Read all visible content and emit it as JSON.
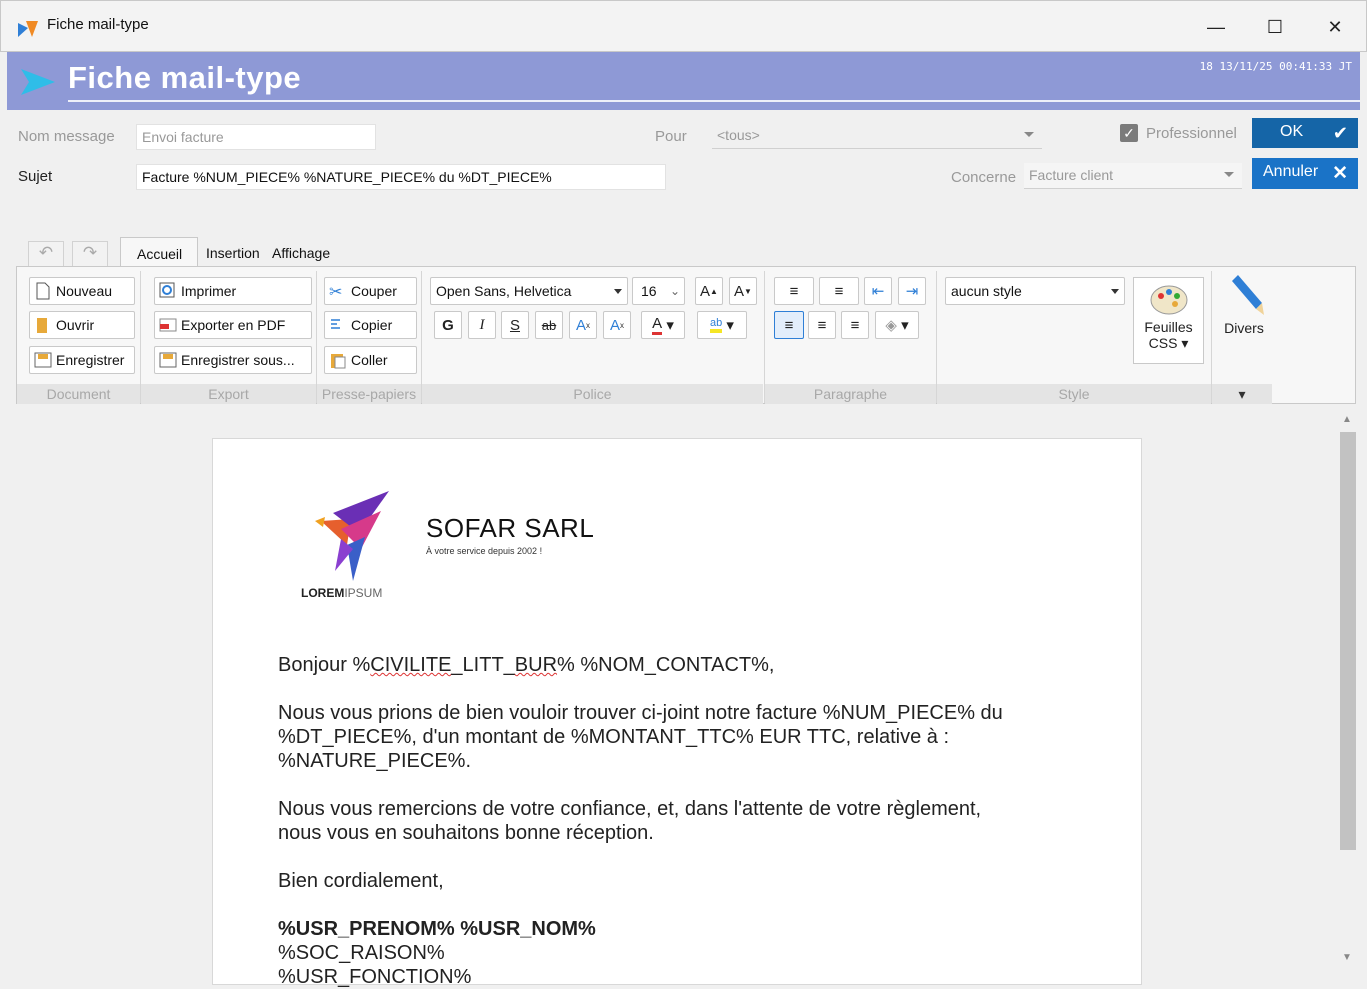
{
  "window": {
    "title": "Fiche mail-type"
  },
  "banner": {
    "title": "Fiche mail-type",
    "meta": "18  13/11/25 00:41:33  JT"
  },
  "form": {
    "nom_message_label": "Nom message",
    "nom_message_value": "Envoi facture",
    "sujet_label": "Sujet",
    "sujet_value": "Facture %NUM_PIECE% %NATURE_PIECE% du %DT_PIECE%",
    "pour_label": "Pour",
    "pour_value": "<tous>",
    "professionnel_label": "Professionnel",
    "professionnel_checked": true,
    "concerne_label": "Concerne",
    "concerne_value": "Facture client",
    "ok_label": "OK",
    "annuler_label": "Annuler"
  },
  "ribbon": {
    "tabs": [
      "Accueil",
      "Insertion",
      "Affichage"
    ],
    "active_tab": "Accueil",
    "document": {
      "nouveau": "Nouveau",
      "ouvrir": "Ouvrir",
      "enregistrer": "Enregistrer",
      "group": "Document"
    },
    "export": {
      "imprimer": "Imprimer",
      "pdf": "Exporter en PDF",
      "enregistrer_sous": "Enregistrer sous...",
      "group": "Export"
    },
    "presse": {
      "couper": "Couper",
      "copier": "Copier",
      "coller": "Coller",
      "group": "Presse-papiers"
    },
    "police": {
      "font": "Open Sans, Helvetica",
      "size": "16",
      "group": "Police",
      "bold": "G",
      "italic": "I",
      "underline": "S",
      "strike": "ab"
    },
    "paragraphe": {
      "group": "Paragraphe"
    },
    "style": {
      "value": "aucun style",
      "feuilles_line1": "Feuilles",
      "feuilles_line2": "CSS",
      "group": "Style"
    },
    "divers": {
      "label": "Divers"
    }
  },
  "document": {
    "company": "SOFAR SARL",
    "tagline": "À votre service depuis 2002 !",
    "logo_text_bold": "LOREM",
    "logo_text_light": "IPSUM",
    "p1": "Bonjour %CIVILITE_LITT_BUR% %NOM_CONTACT%,",
    "p2_l1": "Nous vous prions de bien vouloir trouver ci-joint notre facture %NUM_PIECE% du",
    "p2_l2": "%DT_PIECE%, d'un montant de %MONTANT_TTC% EUR TTC, relative à :",
    "p2_l3": "%NATURE_PIECE%.",
    "p3_l1": "Nous vous remercions de votre confiance, et, dans l'attente de votre règlement,",
    "p3_l2": "nous vous en souhaitons bonne réception.",
    "p4": "Bien cordialement,",
    "sig1": "%USR_PRENOM% %USR_NOM%",
    "sig2": "%SOC_RAISON%",
    "sig3": "%USR_FONCTION%"
  },
  "colors": {
    "banner": "#8e99d6",
    "ok_button": "#1565a7",
    "annuler_button": "#1a73c7"
  }
}
